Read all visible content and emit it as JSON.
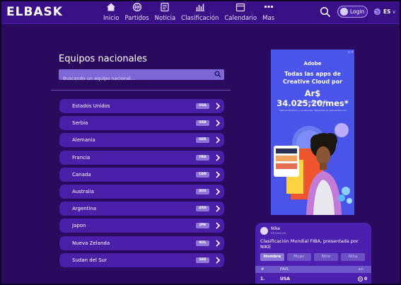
{
  "header": {
    "logo": "ELBASK",
    "nav": [
      {
        "label": "Inicio",
        "icon": "home-icon"
      },
      {
        "label": "Partidos",
        "icon": "basketball-icon"
      },
      {
        "label": "Noticia",
        "icon": "news-icon"
      },
      {
        "label": "Clasificación",
        "icon": "bar-chart-icon"
      },
      {
        "label": "Calendario",
        "icon": "calendar-icon"
      },
      {
        "label": "Mas",
        "icon": "more-icon"
      }
    ],
    "login_label": "Login",
    "language": "ES"
  },
  "main": {
    "title": "Equipos nacionales",
    "search_placeholder": "Buscando un equipo nacional...",
    "teams": [
      {
        "name": "Estados Unidos",
        "code": "USA"
      },
      {
        "name": "Serbia",
        "code": "SRB"
      },
      {
        "name": "Alemania",
        "code": "GER"
      },
      {
        "name": "Francia",
        "code": "FRA"
      },
      {
        "name": "Canada",
        "code": "CAN"
      },
      {
        "name": "Australia",
        "code": "AUS"
      },
      {
        "name": "Argentina",
        "code": "ARG"
      },
      {
        "name": "Japon",
        "code": "JPN"
      },
      {
        "name": "Nueva Zelanda",
        "code": "NZL"
      },
      {
        "name": "Sudan del Sur",
        "code": "SSD"
      }
    ]
  },
  "ad": {
    "brand": "Adobe",
    "headline": "Todas las apps de Creative Cloud por",
    "price": "Ar$ 34.025,20/mes*",
    "sub": "¡Para individuos!",
    "fine_print": "*Aplican términos y condiciones. disponible en www.adobe.com"
  },
  "ranking": {
    "sponsor_name": "Nike",
    "sponsor_tag": "SPONSOR",
    "title": "Clasificación Mundial FIBA, presentada por NIKE",
    "tabs": [
      "Hombre",
      "Mujer",
      "Niño",
      "Niña"
    ],
    "columns": {
      "rank": "#",
      "country": "PAIS",
      "change": "+/-"
    },
    "rows": [
      {
        "rank": "1.",
        "country": "USA",
        "change": "0"
      }
    ]
  },
  "colors": {
    "background": "#2a0a5e",
    "header": "#3a0f86",
    "row": "#4a1ea6",
    "accent": "#8c78d8"
  }
}
